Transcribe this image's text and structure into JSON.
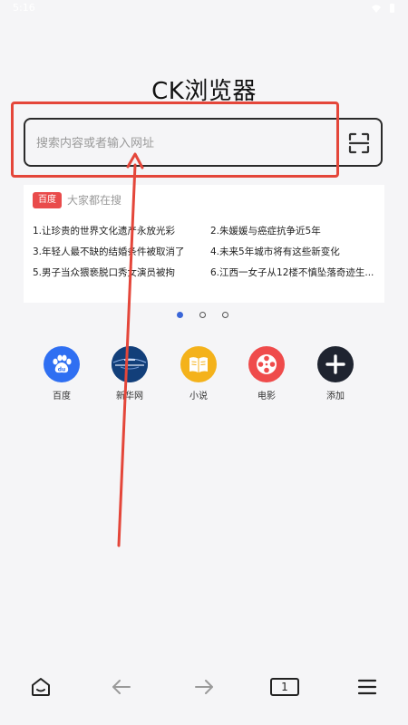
{
  "status_bar": {
    "time": "5:16"
  },
  "app": {
    "title": "CK浏览器"
  },
  "search": {
    "placeholder": "搜索内容或者输入网址"
  },
  "hot_search": {
    "badge": "百度",
    "title": "大家都在搜",
    "items": [
      "1.让珍贵的世界文化遗产永放光彩",
      "2.朱媛媛与癌症抗争近5年",
      "3.年轻人最不缺的结婚条件被取消了",
      "4.未来5年城市将有这些新变化",
      "5.男子当众猥亵脱口秀女演员被拘",
      "6.江西一女子从12楼不慎坠落奇迹生..."
    ]
  },
  "pager": {
    "total": 3,
    "active": 0
  },
  "shortcuts": [
    {
      "label": "百度",
      "icon": "baidu-paw-icon",
      "color": "#2f6ff2"
    },
    {
      "label": "新华网",
      "icon": "xinhua-logo-icon",
      "color": "#123f7a"
    },
    {
      "label": "小说",
      "icon": "book-icon",
      "color": "#f4b21b"
    },
    {
      "label": "电影",
      "icon": "film-reel-icon",
      "color": "#ef4b4b"
    },
    {
      "label": "添加",
      "icon": "plus-icon",
      "color": "#1f2430"
    }
  ],
  "bottom_nav": {
    "tab_count": "1",
    "home_icon": "home-icon",
    "back_icon": "back-arrow-icon",
    "forward_icon": "forward-arrow-icon",
    "menu_icon": "menu-icon"
  },
  "colors": {
    "accent": "#3a66d8",
    "annotation": "#e4463a"
  }
}
